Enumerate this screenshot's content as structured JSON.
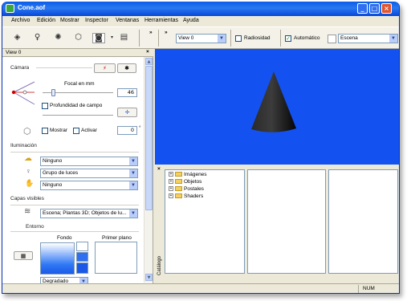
{
  "window": {
    "title": "Cone.aof"
  },
  "menu": [
    "Archivo",
    "Edición",
    "Mostrar",
    "Inspector",
    "Ventanas",
    "Herramientas",
    "Ayuda"
  ],
  "toolbar": {
    "view_combo": "View 0",
    "radiosidad_label": "Radiosidad",
    "automatico_label": "Automático",
    "automatico_checked": "✓",
    "escena_combo": "Escena",
    "chevron1": "»",
    "chevron2": "»"
  },
  "panel": {
    "title": "View 0",
    "close": "×",
    "camera": {
      "heading": "Cámara",
      "focal_label": "Focal en mm",
      "focal_value": "46",
      "dof_label": "Profundidad de campo",
      "show_label": "Mostrar",
      "activate_label": "Activar",
      "angle_value": "0",
      "degree": "°"
    },
    "lighting": {
      "heading": "Iluminación",
      "combo1": "Ninguno",
      "combo2": "Grupo de luces",
      "combo3": "Ninguno"
    },
    "layers": {
      "heading": "Capas visibles",
      "combo": "Escena; Plantas 3D; Objetos de lu..."
    },
    "environment": {
      "heading": "Entorno",
      "fondo_label": "Fondo",
      "primer_plano_label": "Primer plano",
      "degradado_combo": "Degradado"
    }
  },
  "catalog": {
    "close": "×",
    "side_label": "Catálogo",
    "tree": [
      "Imágenes",
      "Objetos",
      "Postales",
      "Shaders"
    ]
  },
  "statusbar": {
    "num": "NUM"
  },
  "colors": {
    "viewport_bg": "#1352f0",
    "title_bar": "#0a5de9"
  }
}
